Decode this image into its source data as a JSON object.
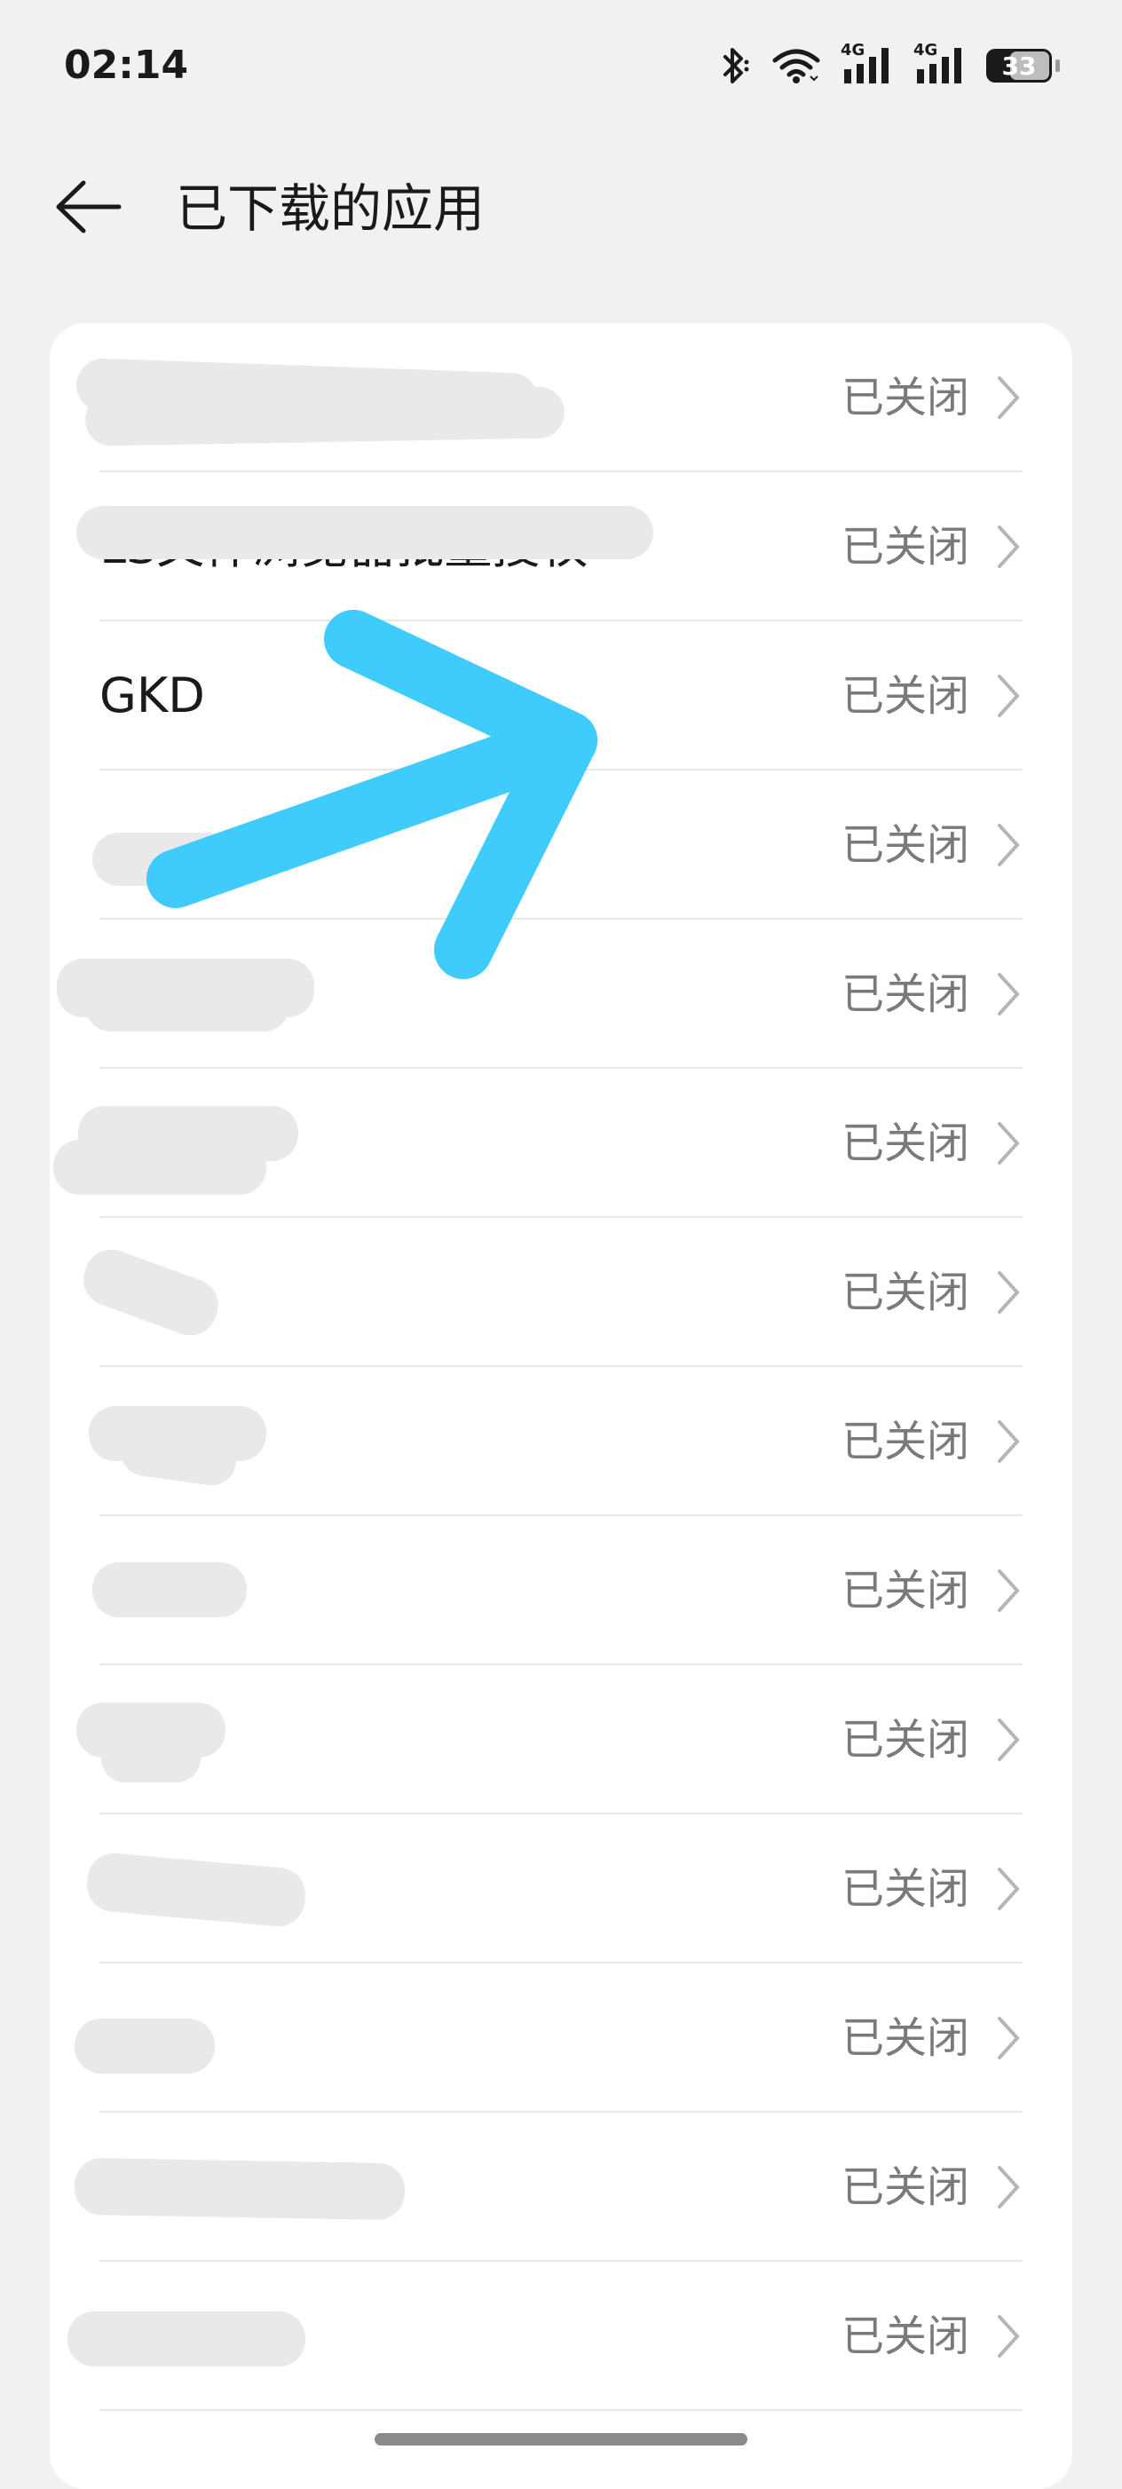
{
  "status_bar": {
    "time": "02:14",
    "battery_level": "33",
    "network_labels": [
      "4G",
      "4G"
    ]
  },
  "header": {
    "title": "已下载的应用",
    "back_icon": "back-arrow-icon"
  },
  "apps": [
    {
      "name": "",
      "status": "已关闭"
    },
    {
      "name": "LS文件浏览器批量授权",
      "status": "已关闭"
    },
    {
      "name": "GKD",
      "status": "已关闭"
    },
    {
      "name": "",
      "status": "已关闭"
    },
    {
      "name": "",
      "status": "已关闭"
    },
    {
      "name": "",
      "status": "已关闭"
    },
    {
      "name": "",
      "status": "已关闭"
    },
    {
      "name": "",
      "status": "已关闭"
    },
    {
      "name": "",
      "status": "已关闭"
    },
    {
      "name": "",
      "status": "已关闭"
    },
    {
      "name": "",
      "status": "已关闭"
    },
    {
      "name": "",
      "status": "已关闭"
    },
    {
      "name": "",
      "status": "已关闭"
    },
    {
      "name": "",
      "status": "已关闭"
    }
  ],
  "colors": {
    "background": "#f0f1f3",
    "card": "#ffffff",
    "status_text": "#7a7a7a",
    "annotation_arrow": "#3fcbfb"
  }
}
